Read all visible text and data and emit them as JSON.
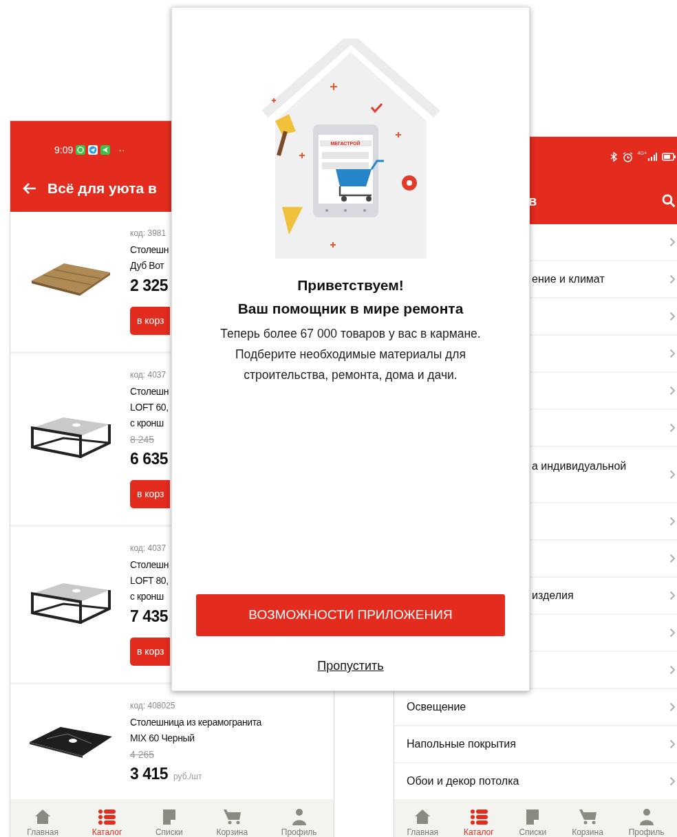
{
  "left_screen": {
    "status_bar": {
      "time": "9:09",
      "more": "··"
    },
    "title": "Всё для уюта в",
    "products": [
      {
        "code": "код: 3981",
        "name": "Столешн\nДуб Вот",
        "price": "2 325",
        "button": "в корз"
      },
      {
        "code": "код: 4037",
        "name": "Столешн\nLOFT 60,\nс кронш",
        "old_price": "8 245",
        "price": "6 635",
        "button": "в корз"
      },
      {
        "code": "код: 4037",
        "name": "Столешн\nLOFT 80,\nс кронш",
        "price": "7 435",
        "button": "в корз"
      },
      {
        "code": "код: 408025",
        "name": "Столешница из керамогранита\nMIX 60 Черный",
        "old_price": "4 265",
        "price": "3 415",
        "unit": "руб./шт"
      }
    ],
    "nav": [
      {
        "label": "Главная",
        "selected": false
      },
      {
        "label": "Каталог",
        "selected": true
      },
      {
        "label": "Списки",
        "selected": false
      },
      {
        "label": "Корзина",
        "selected": false
      },
      {
        "label": "Профиль",
        "selected": false
      }
    ]
  },
  "dialog": {
    "logo_text": "МЕГАСТРОЙ",
    "title_lines": [
      "Приветствуем!",
      "Ваш помощник в мире ремонта"
    ],
    "text": "Теперь более 67 000 товаров у вас в кармане. Подберите необходимые материалы для строительства, ремонта, дома и дачи.",
    "button": "ВОЗМОЖНОСТИ ПРИЛОЖЕНИЯ",
    "skip_link": "Пропустить"
  },
  "right_screen": {
    "status_bar": {
      "network": "4G+"
    },
    "title": "в",
    "rows": [
      {
        "wrapped": false
      },
      {
        "label": "ение и климат",
        "covered": true,
        "wrapped": false
      },
      {
        "wrapped": false
      },
      {
        "wrapped": false
      },
      {
        "wrapped": false
      },
      {
        "wrapped": false
      },
      {
        "label": "а индивидуальной",
        "covered": true,
        "wrapped": true
      },
      {
        "wrapped": false
      },
      {
        "wrapped": false
      },
      {
        "label": "изделия",
        "covered": true,
        "wrapped": false
      },
      {
        "wrapped": false
      },
      {
        "wrapped": false
      },
      {
        "label": "Освещение",
        "covered": false,
        "wrapped": false
      },
      {
        "label": "Напольные покрытия",
        "covered": false,
        "wrapped": false
      },
      {
        "label": "Обои и декор потолка",
        "covered": false,
        "wrapped": false
      }
    ],
    "nav": [
      {
        "label": "Главная",
        "selected": false
      },
      {
        "label": "Каталог",
        "selected": true
      },
      {
        "label": "Списки",
        "selected": false
      },
      {
        "label": "Корзина",
        "selected": false
      },
      {
        "label": "Профиль",
        "selected": false
      }
    ]
  }
}
